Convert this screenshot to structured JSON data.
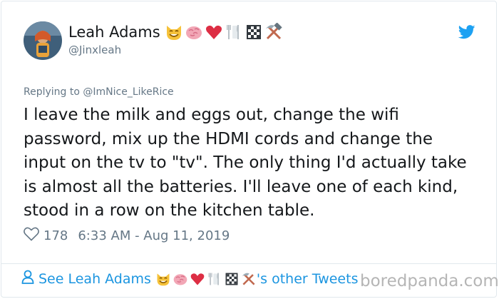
{
  "author": {
    "name": "Leah Adams",
    "handle": "@Jinxleah",
    "name_emojis": [
      "cat-face-emoji",
      "brain-emoji",
      "red-heart-emoji",
      "fork-and-knife-emoji",
      "checkered-square-emoji",
      "hammer-and-pick-emoji"
    ]
  },
  "reply": {
    "prefix": "Replying to ",
    "target": "@ImNice_LikeRice"
  },
  "tweet": {
    "text": "I leave the milk and eggs out, change the wifi password, mix up the HDMI cords and change the input on the tv to \"tv\". The only thing I'd actually take is almost all the batteries. I'll leave one of each kind, stood in a row on the kitchen table."
  },
  "meta": {
    "likes": "178",
    "timestamp": "6:33 AM - Aug 11, 2019"
  },
  "footer": {
    "prefix": "See Leah Adams",
    "suffix": "'s other Tweets"
  },
  "watermark": "boredpanda.com",
  "colors": {
    "link_blue": "#1b95e0",
    "twitter_blue": "#1da1f2",
    "secondary_text": "#657786",
    "border": "#e1e8ed"
  }
}
